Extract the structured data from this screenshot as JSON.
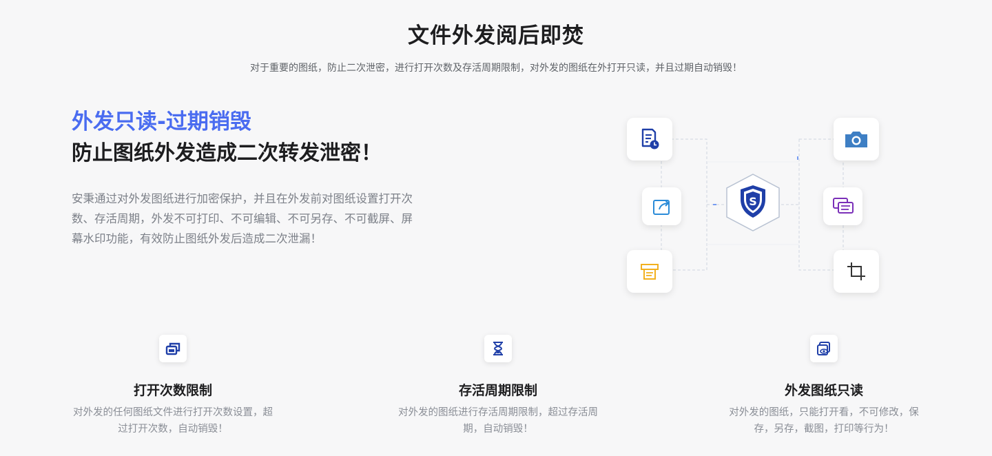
{
  "hero": {
    "title": "文件外发阅后即焚",
    "subtitle": "对于重要的图纸，防止二次泄密，进行打开次数及存活周期限制，对外发的图纸在外打开只读，并且过期自动销毁！"
  },
  "feature": {
    "title_accent": "外发只读-过期销毁",
    "title_main": "防止图纸外发造成二次转发泄密！",
    "description": "安秉通过对外发图纸进行加密保护，并且在外发前对图纸设置打开次数、存活周期，外发不可打印、不可编辑、不可另存、不可截屏、屏幕水印功能，有效防止图纸外发后造成二次泄漏！"
  },
  "diagram": {
    "hub_letter": "S",
    "nodes": [
      {
        "name": "document-clock-icon",
        "color": "#1f3fa8"
      },
      {
        "name": "share-icon",
        "color": "#2a8bd8"
      },
      {
        "name": "printer-icon",
        "color": "#f2b01e"
      },
      {
        "name": "camera-icon",
        "color": "#3e7fc4"
      },
      {
        "name": "messages-icon",
        "color": "#7a2fb8"
      },
      {
        "name": "crop-icon",
        "color": "#333333"
      }
    ],
    "hub_color": "#1f3fa8"
  },
  "cards": [
    {
      "title": "打开次数限制",
      "desc": "对外发的任何图纸文件进行打开次数设置，超过打开次数，自动销毁！",
      "icon": "windows-open-icon"
    },
    {
      "title": "存活周期限制",
      "desc": "对外发的图纸进行存活周期限制，超过存活周期，自动销毁！",
      "icon": "hourglass-icon"
    },
    {
      "title": "外发图纸只读",
      "desc": "对外发的图纸，只能打开看，不可修改，保存，另存，截图，打印等行为！",
      "icon": "view-only-icon"
    }
  ]
}
